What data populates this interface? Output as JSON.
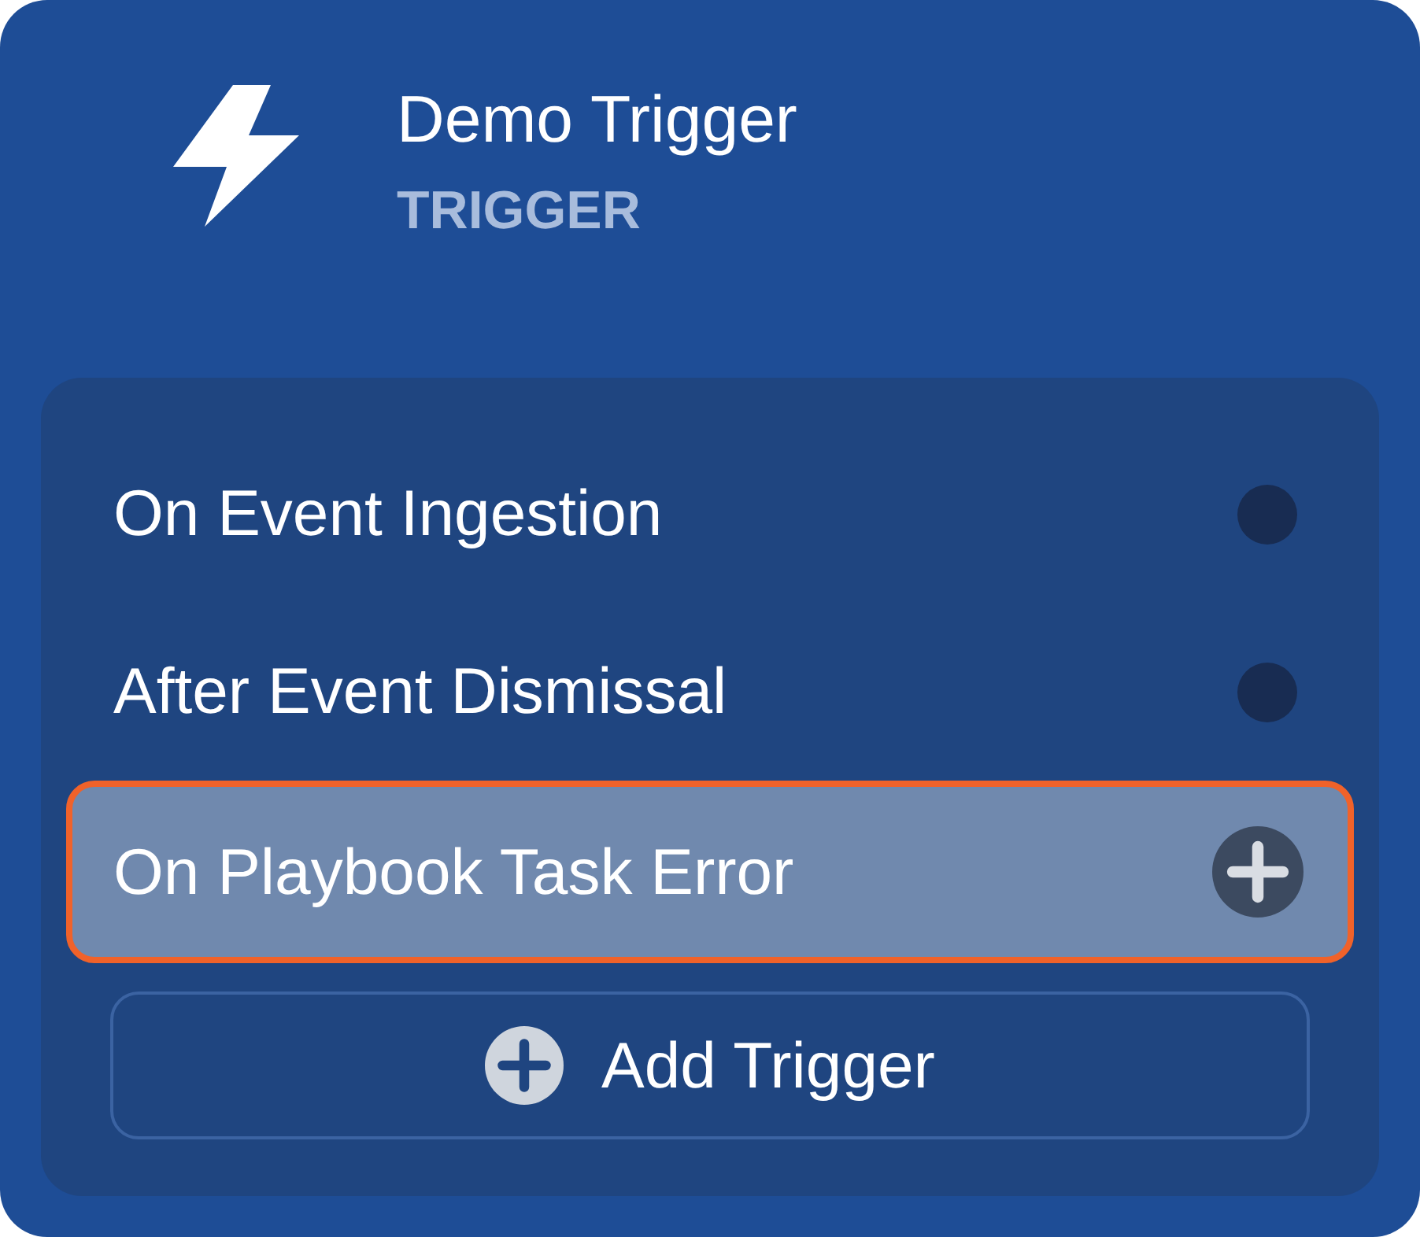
{
  "node": {
    "title": "Demo Trigger",
    "type_label": "TRIGGER"
  },
  "triggers": [
    {
      "label": "On Event Ingestion",
      "selected": false
    },
    {
      "label": "After Event Dismissal",
      "selected": false
    },
    {
      "label": "On Playbook Task Error",
      "selected": true
    }
  ],
  "add_button": {
    "label": "Add Trigger"
  }
}
